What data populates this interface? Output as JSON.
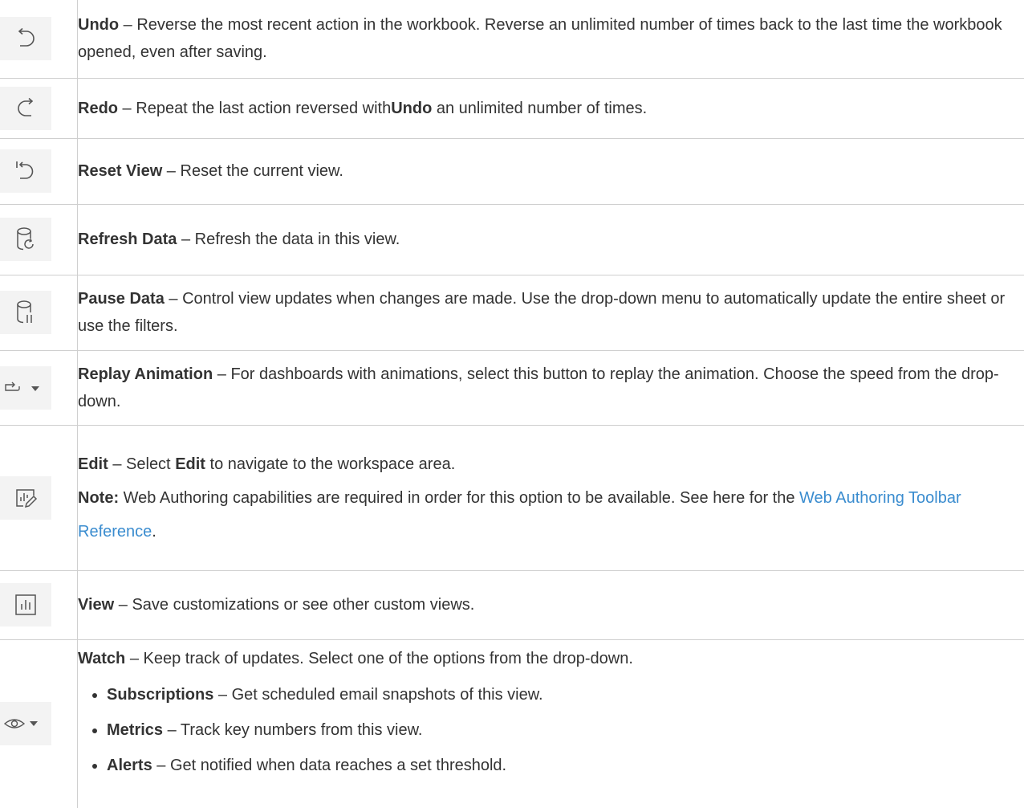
{
  "rows": [
    {
      "icon": "undo-icon",
      "label": "Undo",
      "sep": " – ",
      "text": "Reverse the most recent action in the workbook. Reverse an unlimited number of times back to the last time the workbook opened, even after saving."
    },
    {
      "icon": "redo-icon",
      "label": "Redo",
      "sep": " – ",
      "text_a": "Repeat the last action reversed with",
      "inline_bold": "Undo",
      "text_b": " an unlimited number of times."
    },
    {
      "icon": "reset-view-icon",
      "label": "Reset View",
      "sep": " – ",
      "text": "Reset the current view."
    },
    {
      "icon": "refresh-data-icon",
      "label": "Refresh Data",
      "sep": " – ",
      "text": "Refresh the data in this view."
    },
    {
      "icon": "pause-data-icon",
      "label": "Pause Data",
      "sep": " – ",
      "text": "Control view updates when changes are made. Use the drop-down menu to automatically update the entire sheet or use the filters."
    },
    {
      "icon": "replay-animation-icon",
      "label": "Replay Animation",
      "sep": " – ",
      "text": "For dashboards with animations, select this button to replay the animation. Choose the speed from the drop-down."
    },
    {
      "icon": "edit-icon",
      "label": "Edit",
      "sep": " – ",
      "text_a": "Select ",
      "inline_bold": "Edit",
      "text_b": " to navigate to the workspace area.",
      "note_label": "Note:",
      "note_text": " Web Authoring capabilities are required in order for this option to be available. See here for the ",
      "link_text": "Web Authoring Toolbar Reference",
      "link_after": "."
    },
    {
      "icon": "view-icon",
      "label": "View",
      "sep": " – ",
      "text": "Save customizations or see other custom views."
    },
    {
      "icon": "watch-icon",
      "label": "Watch",
      "sep": " – ",
      "text": "Keep track of updates. Select one of the options from the drop-down.",
      "items": [
        {
          "label": "Subscriptions",
          "sep": " – ",
          "text": "Get scheduled email snapshots of this view."
        },
        {
          "label": "Metrics",
          "sep": " – ",
          "text": "Track key numbers from this view."
        },
        {
          "label": "Alerts",
          "sep": " – ",
          "text": "Get notified when data reaches a set threshold."
        }
      ]
    }
  ]
}
